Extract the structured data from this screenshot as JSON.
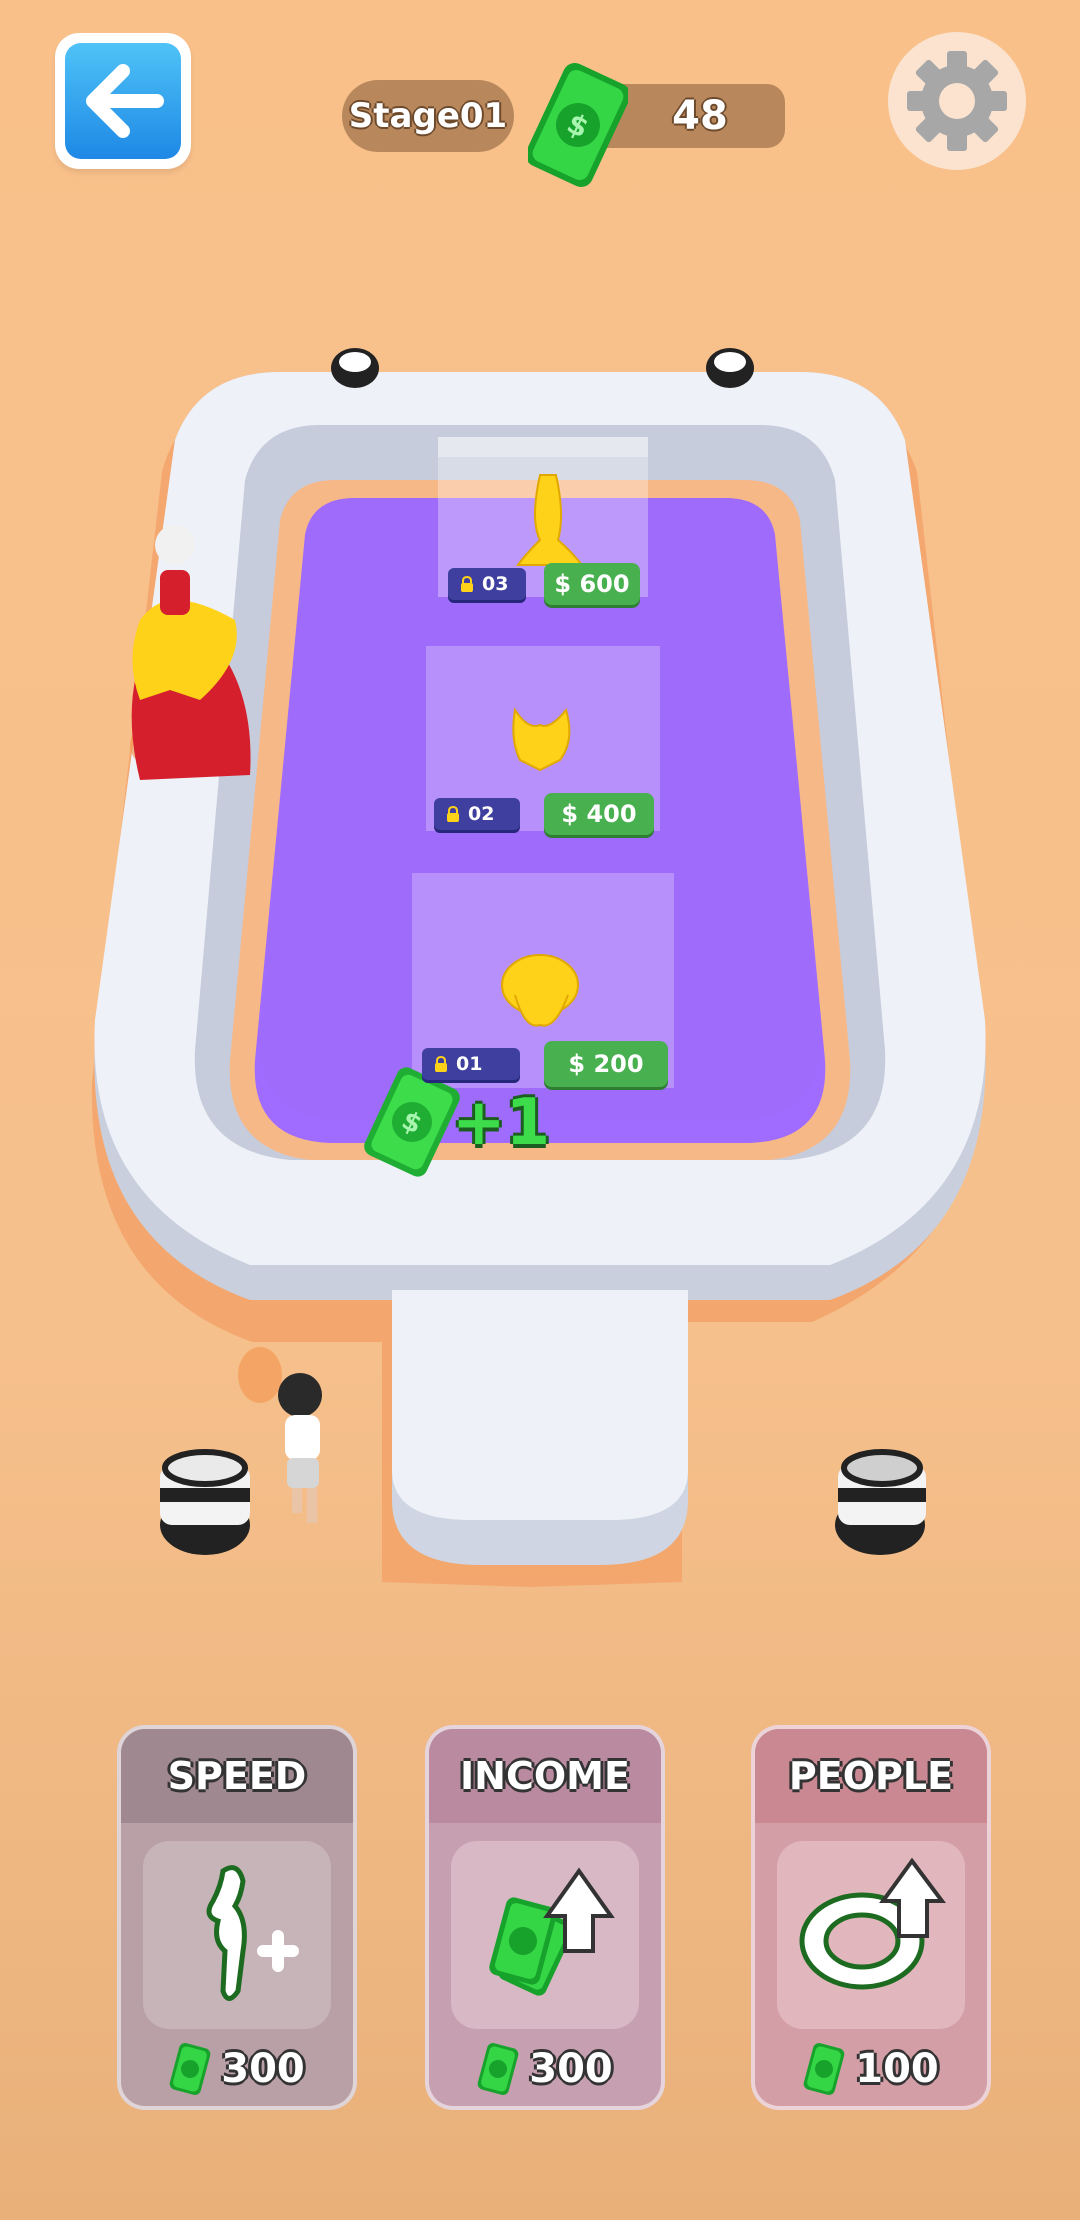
{
  "hud": {
    "stage_label": "Stage01",
    "money": "48"
  },
  "showcases": [
    {
      "lock": "03",
      "price": "$ 600"
    },
    {
      "lock": "02",
      "price": "$ 400"
    },
    {
      "lock": "01",
      "price": "$ 200"
    }
  ],
  "popup": {
    "text": "+1"
  },
  "upgrades": [
    {
      "title": "SPEED",
      "cost": "300",
      "icon": "runner-plus-icon"
    },
    {
      "title": "INCOME",
      "cost": "300",
      "icon": "cash-stack-up-icon"
    },
    {
      "title": "PEOPLE",
      "cost": "100",
      "icon": "ring-up-icon"
    }
  ],
  "colors": {
    "background": "#f9c08a",
    "stage_floor": "#9f6cff",
    "platform": "#e8ecf4",
    "cash_green": "#3ddc4a",
    "price_green": "#49b04f",
    "lock_blue": "#3e3f9e"
  }
}
